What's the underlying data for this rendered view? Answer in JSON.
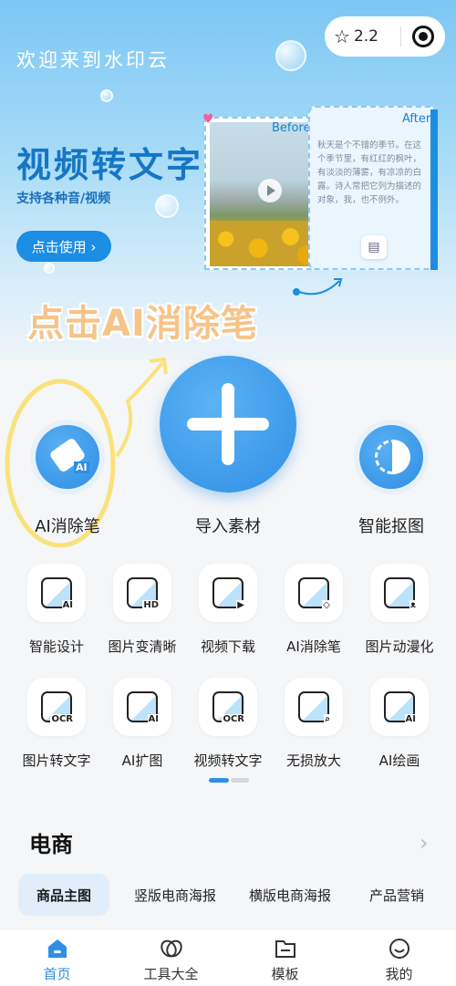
{
  "header": {
    "welcome": "欢迎来到水印云",
    "version": "2.2",
    "star_icon": "star-icon",
    "target_icon": "target-icon"
  },
  "banner": {
    "title": "视频转文字",
    "subtitle": "支持各种音/视频",
    "button_label": "点击使用 ›",
    "before_label": "Before",
    "after_label": "After",
    "sample_text": "秋天是个不错的季节。在这个季节里，有红红的枫叶，有淡淡的薄雾，有凉凉的白露。诗人常把它列为描述的对象，我，也不例外。"
  },
  "callout": "点击AI消除笔",
  "main_actions": {
    "left_label": "AI消除笔",
    "center_label": "导入素材",
    "right_label": "智能抠图"
  },
  "tools": [
    {
      "label": "智能设计",
      "badge": "AI"
    },
    {
      "label": "图片变清晰",
      "badge": "HD"
    },
    {
      "label": "视频下载",
      "badge": "▶"
    },
    {
      "label": "AI消除笔",
      "badge": "◇"
    },
    {
      "label": "图片动漫化",
      "badge": "ᴥ"
    },
    {
      "label": "图片转文字",
      "badge": "OCR"
    },
    {
      "label": "AI扩图",
      "badge": "AI"
    },
    {
      "label": "视频转文字",
      "badge": "OCR"
    },
    {
      "label": "无损放大",
      "badge": "⌕"
    },
    {
      "label": "AI绘画",
      "badge": "AI"
    }
  ],
  "ecommerce": {
    "title": "电商",
    "more": "›",
    "categories": [
      "商品主图",
      "竖版电商海报",
      "横版电商海报",
      "产品营销"
    ]
  },
  "tabbar": [
    {
      "label": "首页",
      "icon": "home-icon"
    },
    {
      "label": "工具大全",
      "icon": "tools-icon"
    },
    {
      "label": "模板",
      "icon": "folder-icon"
    },
    {
      "label": "我的",
      "icon": "smile-icon"
    }
  ],
  "colors": {
    "accent": "#2f8fe6",
    "callout": "#f6c48a",
    "highlight": "#f9e27a"
  }
}
